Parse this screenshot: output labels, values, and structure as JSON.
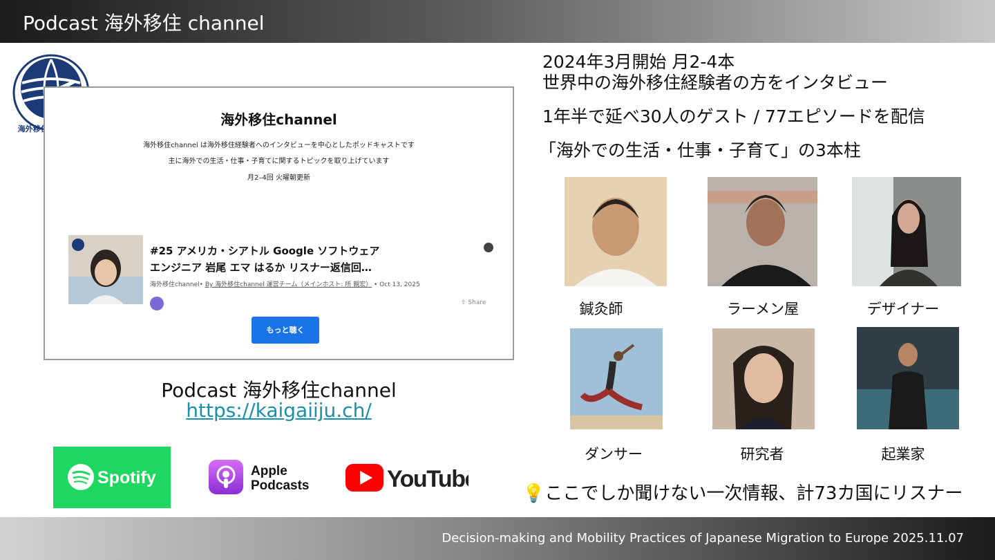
{
  "header": {
    "title": "Podcast 海外移住 channel"
  },
  "footer": {
    "text": "Decision-making and Mobility Practices of Japanese Migration to Europe 2025.11.07"
  },
  "logo": {
    "text": "海外移住 channel"
  },
  "site": {
    "title": "海外移住channel",
    "desc1": "海外移住channel は海外移住経験者へのインタビューを中心としたポッドキャストです",
    "desc2": "主に海外での生活・仕事・子育てに関するトピックを取り上げています",
    "desc3": "月2–4回 火曜朝更新",
    "episode_title1": "#25 アメリカ・シアトル Google ソフトウェア",
    "episode_title2": "エンジニア 岩尾 エマ はるか リスナー返信回…",
    "episode_meta_prefix": "海外移住channel•",
    "episode_meta_by": "By 海外移住channel 運営チーム（メインホスト: 所 親宏）",
    "episode_meta_date": "• Oct 13, 2025",
    "share_label": "Share",
    "more_button": "もっと聴く"
  },
  "podcast": {
    "name": "Podcast 海外移住channel",
    "url": "https://kaigaiiju.ch/"
  },
  "platforms": {
    "spotify": "Spotify",
    "apple_line1": "Apple",
    "apple_line2": "Podcasts",
    "youtube": "YouTube"
  },
  "info": {
    "line1": "2024年3月開始 月2-4本",
    "line2": "世界中の海外移住経験者の方をインタビュー",
    "line3": "1年半で延べ30人のゲスト / 77エピソードを配信",
    "line4": "「海外での生活・仕事・子育て」の3本柱"
  },
  "guests": [
    {
      "label": "鍼灸師"
    },
    {
      "label": "ラーメン屋"
    },
    {
      "label": "デザイナー"
    },
    {
      "label": "ダンサー"
    },
    {
      "label": "研究者"
    },
    {
      "label": "起業家"
    }
  ],
  "bottom": {
    "icon": "lightbulb-icon",
    "text": "ここでしか聞けない一次情報、計73カ国にリスナー"
  }
}
